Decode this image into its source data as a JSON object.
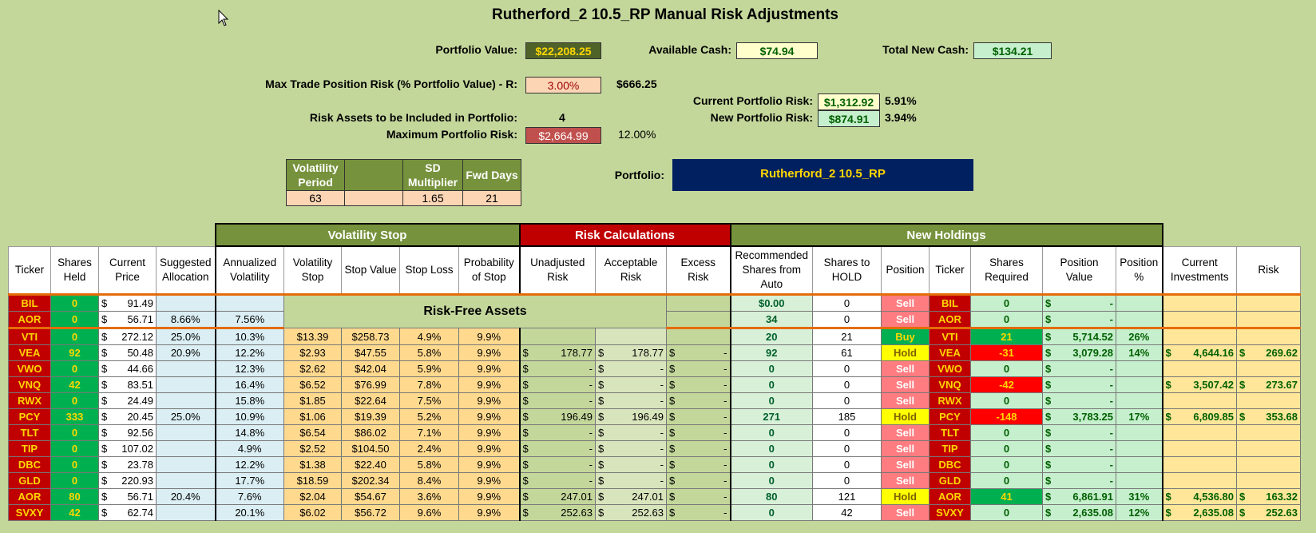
{
  "title": "Rutherford_2 10.5_RP Manual Risk Adjustments",
  "portfolio_value": {
    "label": "Portfolio Value:",
    "value": "$22,208.25"
  },
  "available_cash": {
    "label": "Available Cash:",
    "value": "$74.94"
  },
  "total_new_cash": {
    "label": "Total New Cash:",
    "value": "$134.21"
  },
  "max_trade": {
    "label": "Max Trade Position Risk (% Portfolio Value) - R:",
    "value": "3.00%",
    "amount": "$666.25"
  },
  "current_risk": {
    "label": "Current Portfolio Risk:",
    "value": "$1,312.92",
    "pct": "5.91%"
  },
  "new_risk": {
    "label": "New Portfolio Risk:",
    "value": "$874.91",
    "pct": "3.94%"
  },
  "risk_assets": {
    "label": "Risk Assets to be Included in Portfolio:",
    "value": "4"
  },
  "max_portfolio_risk": {
    "label": "Maximum Portfolio Risk:",
    "value": "$2,664.99",
    "pct": "12.00%"
  },
  "params": {
    "vol_period_label": "Volatility Period",
    "vol_period": "63",
    "sd_label": "SD Multiplier",
    "sd": "1.65",
    "fwd_label": "Fwd Days",
    "fwd": "21"
  },
  "portfolio": {
    "label": "Portfolio:",
    "name": "Rutherford_2 10.5_RP"
  },
  "groups": {
    "vol_stop": "Volatility Stop",
    "risk_calc": "Risk Calculations",
    "new_holdings": "New Holdings"
  },
  "columns": [
    "Ticker",
    "Shares Held",
    "Current Price",
    "Suggested Allocation",
    "Annualized Volatility",
    "Volatility Stop",
    "Stop Value",
    "Stop Loss",
    "Probability of Stop",
    "Unadjusted Risk",
    "Acceptable Risk",
    "Excess Risk",
    "Recommended Shares from Auto",
    "Shares to HOLD",
    "Position",
    "Ticker",
    "Shares Required",
    "Position Value",
    "Position %",
    "Current Investments",
    "Risk"
  ],
  "risk_free_label": "Risk-Free Assets",
  "risk_free_rows": [
    {
      "ticker": "BIL",
      "held": "0",
      "price": "91.49",
      "alloc": "",
      "vol": "",
      "rec": "$0.00",
      "hold": "0",
      "pos": "Sell",
      "req": "0",
      "pv": "-"
    },
    {
      "ticker": "AOR",
      "held": "0",
      "price": "56.71",
      "alloc": "8.66%",
      "vol": "7.56%",
      "rec": "34",
      "hold": "0",
      "pos": "Sell",
      "req": "0",
      "pv": "-"
    }
  ],
  "rows": [
    {
      "ticker": "VTI",
      "held": "0",
      "price": "272.12",
      "alloc": "25.0%",
      "vol": "10.3%",
      "vstop": "$13.39",
      "sval": "$258.73",
      "sloss": "4.9%",
      "prob": "9.9%",
      "unadj": "",
      "acc": "",
      "excess": "",
      "rec": "20",
      "hold": "21",
      "pos": "Buy",
      "req": "21",
      "pv": "5,714.52",
      "ppct": "26%",
      "inv": "",
      "risk": ""
    },
    {
      "ticker": "VEA",
      "held": "92",
      "price": "50.48",
      "alloc": "20.9%",
      "vol": "12.2%",
      "vstop": "$2.93",
      "sval": "$47.55",
      "sloss": "5.8%",
      "prob": "9.9%",
      "unadj": "178.77",
      "acc": "178.77",
      "excess": "-",
      "rec": "92",
      "hold": "61",
      "pos": "Hold",
      "req": "-31",
      "pv": "3,079.28",
      "ppct": "14%",
      "inv": "4,644.16",
      "risk": "269.62"
    },
    {
      "ticker": "VWO",
      "held": "0",
      "price": "44.66",
      "alloc": "",
      "vol": "12.3%",
      "vstop": "$2.62",
      "sval": "$42.04",
      "sloss": "5.9%",
      "prob": "9.9%",
      "unadj": "-",
      "acc": "-",
      "excess": "-",
      "rec": "0",
      "hold": "0",
      "pos": "Sell",
      "req": "0",
      "pv": "-",
      "ppct": "",
      "inv": "",
      "risk": ""
    },
    {
      "ticker": "VNQ",
      "held": "42",
      "price": "83.51",
      "alloc": "",
      "vol": "16.4%",
      "vstop": "$6.52",
      "sval": "$76.99",
      "sloss": "7.8%",
      "prob": "9.9%",
      "unadj": "-",
      "acc": "-",
      "excess": "-",
      "rec": "0",
      "hold": "0",
      "pos": "Sell",
      "req": "-42",
      "pv": "-",
      "ppct": "",
      "inv": "3,507.42",
      "risk": "273.67"
    },
    {
      "ticker": "RWX",
      "held": "0",
      "price": "24.49",
      "alloc": "",
      "vol": "15.8%",
      "vstop": "$1.85",
      "sval": "$22.64",
      "sloss": "7.5%",
      "prob": "9.9%",
      "unadj": "-",
      "acc": "-",
      "excess": "-",
      "rec": "0",
      "hold": "0",
      "pos": "Sell",
      "req": "0",
      "pv": "-",
      "ppct": "",
      "inv": "",
      "risk": ""
    },
    {
      "ticker": "PCY",
      "held": "333",
      "price": "20.45",
      "alloc": "25.0%",
      "vol": "10.9%",
      "vstop": "$1.06",
      "sval": "$19.39",
      "sloss": "5.2%",
      "prob": "9.9%",
      "unadj": "196.49",
      "acc": "196.49",
      "excess": "-",
      "rec": "271",
      "hold": "185",
      "pos": "Hold",
      "req": "-148",
      "pv": "3,783.25",
      "ppct": "17%",
      "inv": "6,809.85",
      "risk": "353.68"
    },
    {
      "ticker": "TLT",
      "held": "0",
      "price": "92.56",
      "alloc": "",
      "vol": "14.8%",
      "vstop": "$6.54",
      "sval": "$86.02",
      "sloss": "7.1%",
      "prob": "9.9%",
      "unadj": "-",
      "acc": "-",
      "excess": "-",
      "rec": "0",
      "hold": "0",
      "pos": "Sell",
      "req": "0",
      "pv": "-",
      "ppct": "",
      "inv": "",
      "risk": ""
    },
    {
      "ticker": "TIP",
      "held": "0",
      "price": "107.02",
      "alloc": "",
      "vol": "4.9%",
      "vstop": "$2.52",
      "sval": "$104.50",
      "sloss": "2.4%",
      "prob": "9.9%",
      "unadj": "-",
      "acc": "-",
      "excess": "-",
      "rec": "0",
      "hold": "0",
      "pos": "Sell",
      "req": "0",
      "pv": "-",
      "ppct": "",
      "inv": "",
      "risk": ""
    },
    {
      "ticker": "DBC",
      "held": "0",
      "price": "23.78",
      "alloc": "",
      "vol": "12.2%",
      "vstop": "$1.38",
      "sval": "$22.40",
      "sloss": "5.8%",
      "prob": "9.9%",
      "unadj": "-",
      "acc": "-",
      "excess": "-",
      "rec": "0",
      "hold": "0",
      "pos": "Sell",
      "req": "0",
      "pv": "-",
      "ppct": "",
      "inv": "",
      "risk": ""
    },
    {
      "ticker": "GLD",
      "held": "0",
      "price": "220.93",
      "alloc": "",
      "vol": "17.7%",
      "vstop": "$18.59",
      "sval": "$202.34",
      "sloss": "8.4%",
      "prob": "9.9%",
      "unadj": "-",
      "acc": "-",
      "excess": "-",
      "rec": "0",
      "hold": "0",
      "pos": "Sell",
      "req": "0",
      "pv": "-",
      "ppct": "",
      "inv": "",
      "risk": ""
    },
    {
      "ticker": "AOR",
      "held": "80",
      "price": "56.71",
      "alloc": "20.4%",
      "vol": "7.6%",
      "vstop": "$2.04",
      "sval": "$54.67",
      "sloss": "3.6%",
      "prob": "9.9%",
      "unadj": "247.01",
      "acc": "247.01",
      "excess": "-",
      "rec": "80",
      "hold": "121",
      "pos": "Hold",
      "req": "41",
      "pv": "6,861.91",
      "ppct": "31%",
      "inv": "4,536.80",
      "risk": "163.32"
    },
    {
      "ticker": "SVXY",
      "held": "42",
      "price": "62.74",
      "alloc": "",
      "vol": "20.1%",
      "vstop": "$6.02",
      "sval": "$56.72",
      "sloss": "9.6%",
      "prob": "9.9%",
      "unadj": "252.63",
      "acc": "252.63",
      "excess": "-",
      "rec": "0",
      "hold": "42",
      "pos": "Sell",
      "req": "0",
      "pv": "2,635.08",
      "ppct": "12%",
      "inv": "2,635.08",
      "risk": "252.63"
    }
  ],
  "currency": "$"
}
